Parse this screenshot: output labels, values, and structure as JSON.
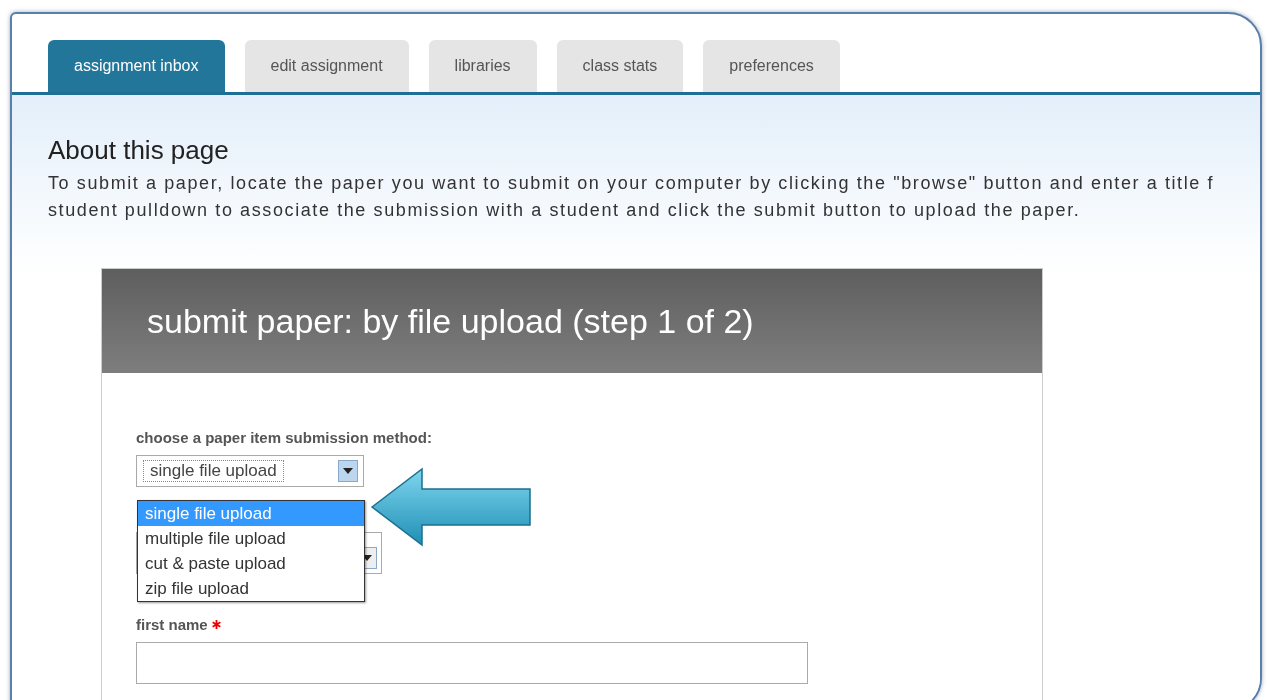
{
  "tabs": [
    {
      "label": "assignment inbox",
      "selected": true
    },
    {
      "label": "edit assignment",
      "selected": false
    },
    {
      "label": "libraries",
      "selected": false
    },
    {
      "label": "class stats",
      "selected": false
    },
    {
      "label": "preferences",
      "selected": false
    }
  ],
  "about": {
    "title": "About this page",
    "lines": [
      "To submit a paper, locate the paper you want to submit on your computer by clicking the \"browse\" button and enter a title f",
      "student pulldown to associate the submission with a student and click the submit button to upload the paper."
    ]
  },
  "panel": {
    "title": "submit paper: by file upload (step 1 of 2)",
    "method_label": "choose a paper item submission method:",
    "method_select": {
      "value": "single file upload",
      "expanded": true,
      "options": [
        {
          "label": "single file upload",
          "selected": true
        },
        {
          "label": "multiple file upload",
          "selected": false
        },
        {
          "label": "cut & paste upload",
          "selected": false
        },
        {
          "label": "zip file upload",
          "selected": false
        }
      ]
    },
    "first_name": {
      "label": "first name",
      "required": true
    }
  }
}
